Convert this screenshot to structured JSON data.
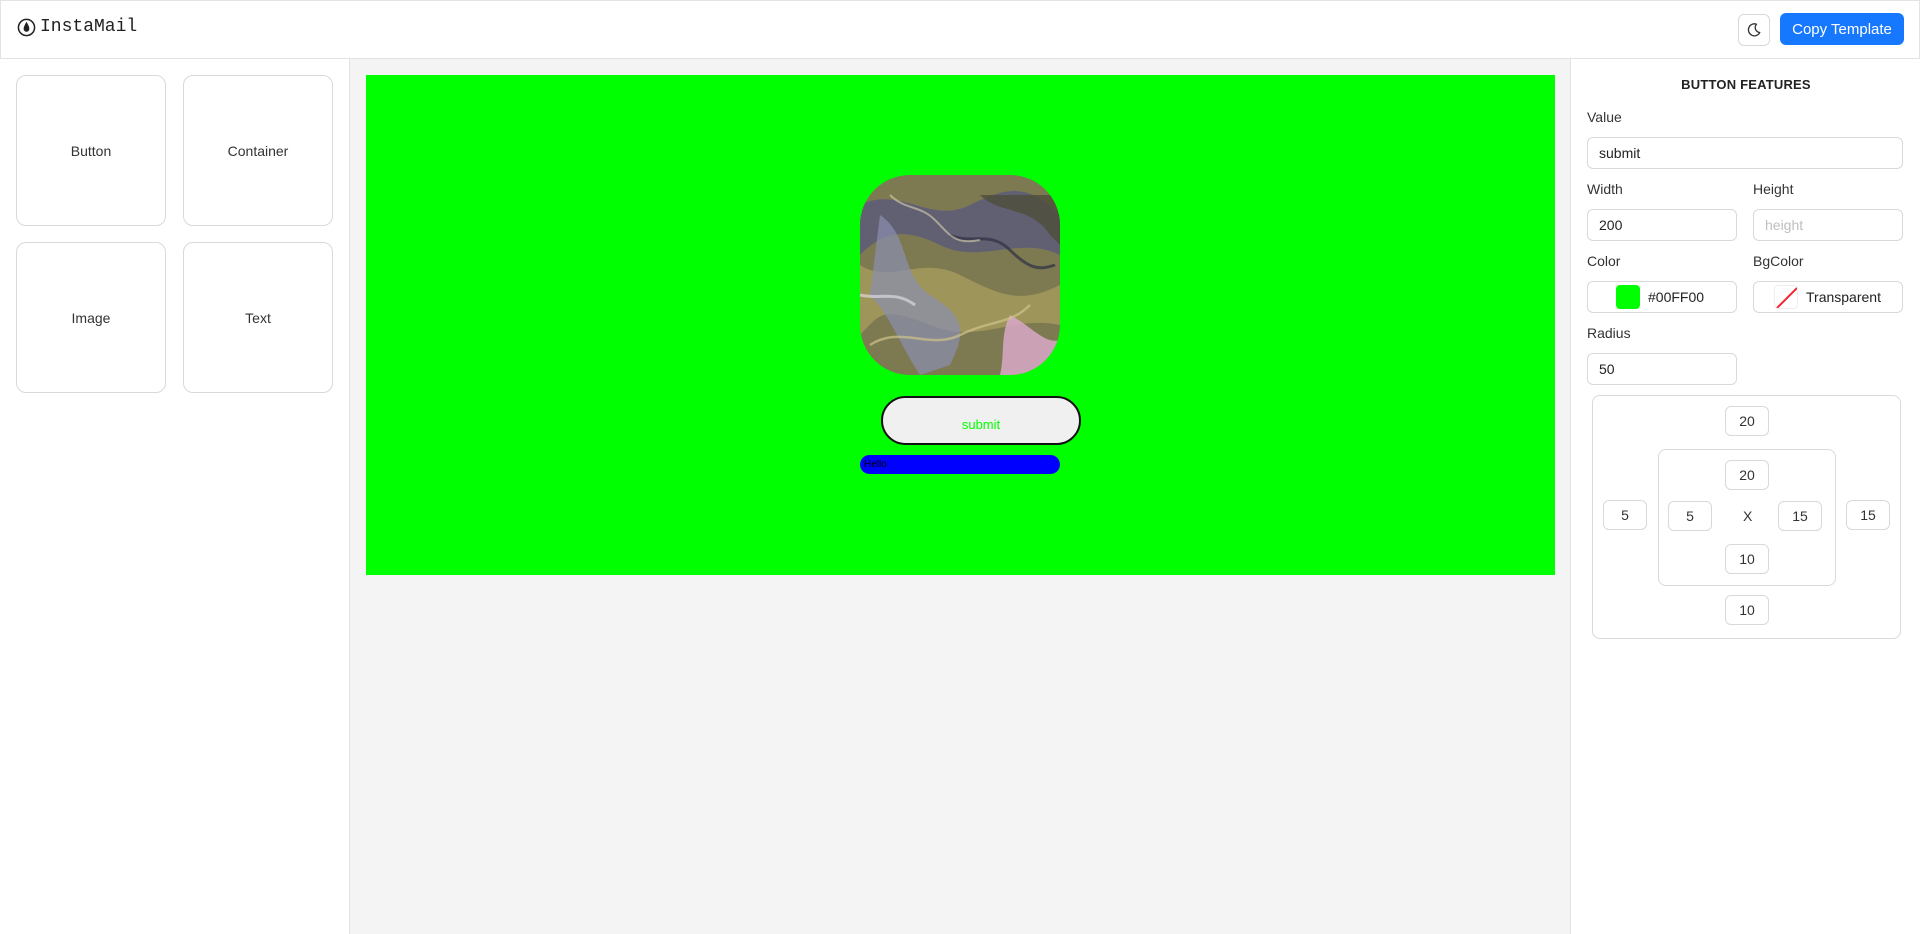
{
  "header": {
    "app_name": "InstaMail",
    "copy_button": "Copy Template",
    "theme_icon": "moon-icon"
  },
  "tools": [
    {
      "label": "Button"
    },
    {
      "label": "Container"
    },
    {
      "label": "Image"
    },
    {
      "label": "Text"
    }
  ],
  "canvas": {
    "container_bg": "#00FF00",
    "button_text": "submit",
    "button_text_color": "#00FF00",
    "text_block_bg": "#0000FF",
    "text_block_text": "Hello"
  },
  "panel": {
    "title": "BUTTON FEATURES",
    "value_label": "Value",
    "value": "submit",
    "width_label": "Width",
    "width": "200",
    "height_label": "Height",
    "height_placeholder": "height",
    "color_label": "Color",
    "color": "#00FF00",
    "bgcolor_label": "BgColor",
    "bgcolor": "Transparent",
    "radius_label": "Radius",
    "radius": "50",
    "margin": {
      "top": "20",
      "bottom": "10",
      "left": "5",
      "right": "15"
    },
    "padding": {
      "top": "20",
      "bottom": "10",
      "left": "5",
      "right": "15"
    },
    "center_mark": "X"
  }
}
